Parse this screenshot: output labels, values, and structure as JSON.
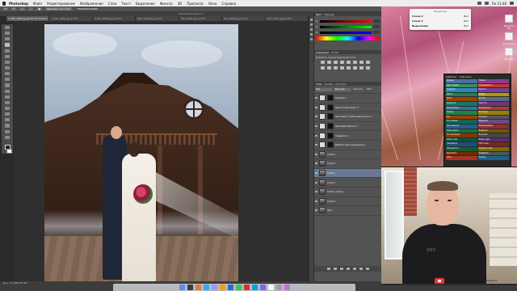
{
  "menubar": {
    "app": "Photoshop",
    "items": [
      "Файл",
      "Редактирование",
      "Изображение",
      "Слои",
      "Текст",
      "Выделение",
      "Фильтр",
      "3D",
      "Просмотр",
      "Окно",
      "Справка"
    ],
    "clock": "Пн 11:46"
  },
  "options": {
    "sample_label": "Образец: все слои",
    "button": "Уточнить край"
  },
  "app_title": "Adobe Photoshop CC",
  "doc_tabs": [
    "1_DSC_5567.jpg @ 33,3% (Слой 1, RGB/8)",
    "2_DSC_5590.jpg @ 25%",
    "3_DSC_5602.jpg @ 25%",
    "DSC_5618.jpg @ 25%",
    "DSC_5644.jpg @ 25%",
    "DSC_5650.jpg @ 25%",
    "DSC_5671.jpg @ 25%"
  ],
  "color_panel": {
    "tabs": [
      "Цвет",
      "Образцы"
    ],
    "channels": [
      "R",
      "G",
      "B"
    ]
  },
  "adjust_panel": {
    "tabs": [
      "Коррекция",
      "Стили"
    ],
    "hint": "Добавить корректирующий слой"
  },
  "layers_panel": {
    "tabs": [
      "Слои",
      "Каналы",
      "Контуры"
    ],
    "kind": "Вид",
    "blend": "Обычные",
    "opacity_label": "Непрозр.:",
    "opacity_value": "100%",
    "layers": [
      "Кривые 1",
      "Яркость/Контраст 1",
      "Цветовой тон/Насыщенность 1",
      "Цветовой баланс 1",
      "Градиент 1",
      "Выборочная коррекция 1",
      "Слой 4",
      "Слой 3",
      "Слой 1",
      "Слой 2",
      "Слой 1 копия",
      "Слой 0",
      "Фон"
    ]
  },
  "status": {
    "text": "Док: 34,3M/216,4M"
  },
  "dialog": {
    "title": "Выделение",
    "rows": [
      {
        "label": "Слоев 2",
        "value": "Вкл"
      },
      {
        "label": "Слоев 3",
        "value": "Вкл"
      },
      {
        "label": "Выделение",
        "value": "Вкл"
      }
    ]
  },
  "desktop_icons": [
    "Macintosh HD",
    "Документы",
    "Загрузки"
  ],
  "prompt_panel": {
    "tabs": [
      "Шаблоны",
      "Подсказки"
    ],
    "cells": [
      {
        "text": "Кривые",
        "color": "#4a6fa5"
      },
      {
        "text": "Уровни",
        "color": "#8a3f8e"
      },
      {
        "text": "Цвет. баланс",
        "color": "#3f8e5a"
      },
      {
        "text": "Насыщенность",
        "color": "#c0392b"
      },
      {
        "text": "Градиент",
        "color": "#2e86c1"
      },
      {
        "text": "Яркость",
        "color": "#7d3c98"
      },
      {
        "text": "Маска",
        "color": "#1e8449"
      },
      {
        "text": "Штамп",
        "color": "#b7950b"
      },
      {
        "text": "Кисть",
        "color": "#a04000"
      },
      {
        "text": "Ластик",
        "color": "#5d6d7e"
      },
      {
        "text": "Размытие",
        "color": "#117864"
      },
      {
        "text": "Резкость",
        "color": "#6c3483"
      },
      {
        "text": "Осветлитель",
        "color": "#2874a6"
      },
      {
        "text": "Затемнитель",
        "color": "#b03a2e"
      },
      {
        "text": "Фильтр",
        "color": "#1d8348"
      },
      {
        "text": "Пластика",
        "color": "#9a7d0a"
      },
      {
        "text": "Тон",
        "color": "#a04000"
      },
      {
        "text": "Контраст",
        "color": "#515a5a"
      },
      {
        "text": "Экспозиция",
        "color": "#0e6655"
      },
      {
        "text": "Вибрация",
        "color": "#76448a"
      },
      {
        "text": "Фото фильтр",
        "color": "#1f618d"
      },
      {
        "text": "Микширование",
        "color": "#943126"
      },
      {
        "text": "Поиск цвета",
        "color": "#196f3d"
      },
      {
        "text": "Инверсия",
        "color": "#7e5109"
      },
      {
        "text": "Постеризация",
        "color": "#873600"
      },
      {
        "text": "Изогелия",
        "color": "#424949"
      },
      {
        "text": "Карта град.",
        "color": "#0b5345"
      },
      {
        "text": "Выбор. цвет",
        "color": "#5b2c6f"
      },
      {
        "text": "Тени/Света",
        "color": "#1a5276"
      },
      {
        "text": "HDR тонир.",
        "color": "#78281f"
      },
      {
        "text": "Обесцветить",
        "color": "#145a32"
      },
      {
        "text": "Заменить цвет",
        "color": "#7d6608"
      },
      {
        "text": "Выровнять",
        "color": "#6e2c00"
      },
      {
        "text": "Подобрать",
        "color": "#4d5656"
      },
      {
        "text": "Слои",
        "color": "#a93226"
      },
      {
        "text": "Каналы",
        "color": "#1f618d"
      }
    ]
  },
  "webcam": {
    "shirt_text": "DEV",
    "end_label": "Закрыть"
  },
  "dock_icons": [
    "#5b8def",
    "#3c3c3c",
    "#e07b39",
    "#31a8ff",
    "#9999ff",
    "#ff9a00",
    "#2a6bd1",
    "#34c759",
    "#d13438",
    "#00a2ed",
    "#7b68ee",
    "#f5f5f5",
    "#a0a0a0",
    "#c86dd7"
  ]
}
